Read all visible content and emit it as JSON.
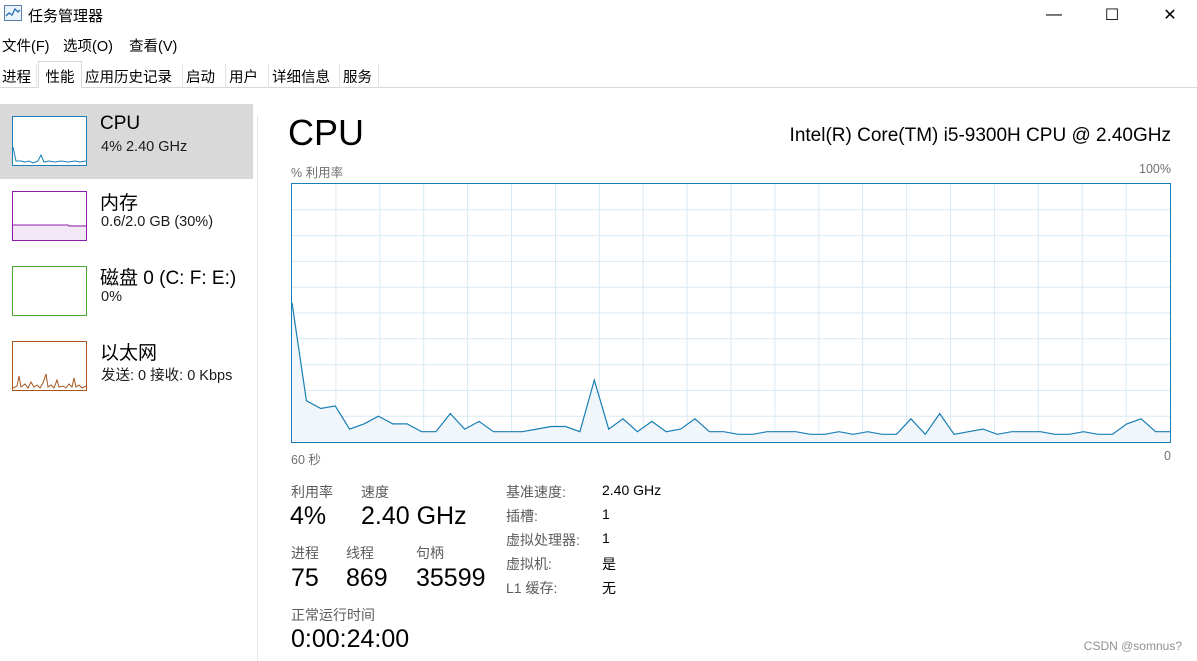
{
  "window": {
    "title": "任务管理器",
    "controls": {
      "minimize": "—",
      "maximize": "☐",
      "close": "✕"
    }
  },
  "menu": [
    "文件(F)",
    "选项(O)",
    "查看(V)"
  ],
  "tabs": [
    {
      "label": "进程"
    },
    {
      "label": "性能",
      "active": true
    },
    {
      "label": "应用历史记录"
    },
    {
      "label": "启动"
    },
    {
      "label": "用户"
    },
    {
      "label": "详细信息"
    },
    {
      "label": "服务"
    }
  ],
  "sidebar": {
    "items": [
      {
        "name": "CPU",
        "sub": "4% 2.40 GHz",
        "color": "#1a7fb5",
        "selected": true
      },
      {
        "name": "内存",
        "sub": "0.6/2.0 GB (30%)",
        "color": "#8b1ea8"
      },
      {
        "name": "磁盘 0 (C: F: E:)",
        "sub": "0%",
        "color": "#4aa832"
      },
      {
        "name": "以太网",
        "sub": "发送: 0 接收: 0 Kbps",
        "color": "#a8561e"
      }
    ]
  },
  "main": {
    "title": "CPU",
    "model": "Intel(R) Core(TM) i5-9300H CPU @ 2.40GHz",
    "graph": {
      "ylabel": "% 利用率",
      "ymax_label": "100%",
      "xleft_label": "60 秒",
      "xright_label": "0",
      "line_color": "#1a7fb5",
      "fill_color": "#f1f6fa",
      "grid_color": "#d9eaf4",
      "ylim": [
        0,
        100
      ],
      "values": [
        54,
        16,
        13,
        14,
        5,
        7,
        10,
        7,
        7,
        4,
        4,
        11,
        5,
        8,
        4,
        4,
        4,
        5,
        6,
        6,
        4,
        24,
        5,
        9,
        4,
        8,
        4,
        5,
        9,
        4,
        4,
        3,
        3,
        4,
        4,
        4,
        3,
        3,
        4,
        3,
        4,
        3,
        3,
        9,
        3,
        11,
        3,
        4,
        5,
        3,
        4,
        4,
        4,
        3,
        3,
        4,
        3,
        3,
        7,
        9,
        4,
        4
      ]
    },
    "stats": {
      "utilization_label": "利用率",
      "utilization": "4%",
      "speed_label": "速度",
      "speed": "2.40 GHz",
      "processes_label": "进程",
      "processes": "75",
      "threads_label": "线程",
      "threads": "869",
      "handles_label": "句柄",
      "handles": "35599",
      "uptime_label": "正常运行时间",
      "uptime": "0:00:24:00"
    },
    "details": [
      {
        "label": "基准速度:",
        "value": "2.40 GHz"
      },
      {
        "label": "插槽:",
        "value": "1"
      },
      {
        "label": "虚拟处理器:",
        "value": "1"
      },
      {
        "label": "虚拟机:",
        "value": "是"
      },
      {
        "label": "L1 缓存:",
        "value": "无"
      }
    ]
  },
  "watermark": "CSDN @somnus?"
}
